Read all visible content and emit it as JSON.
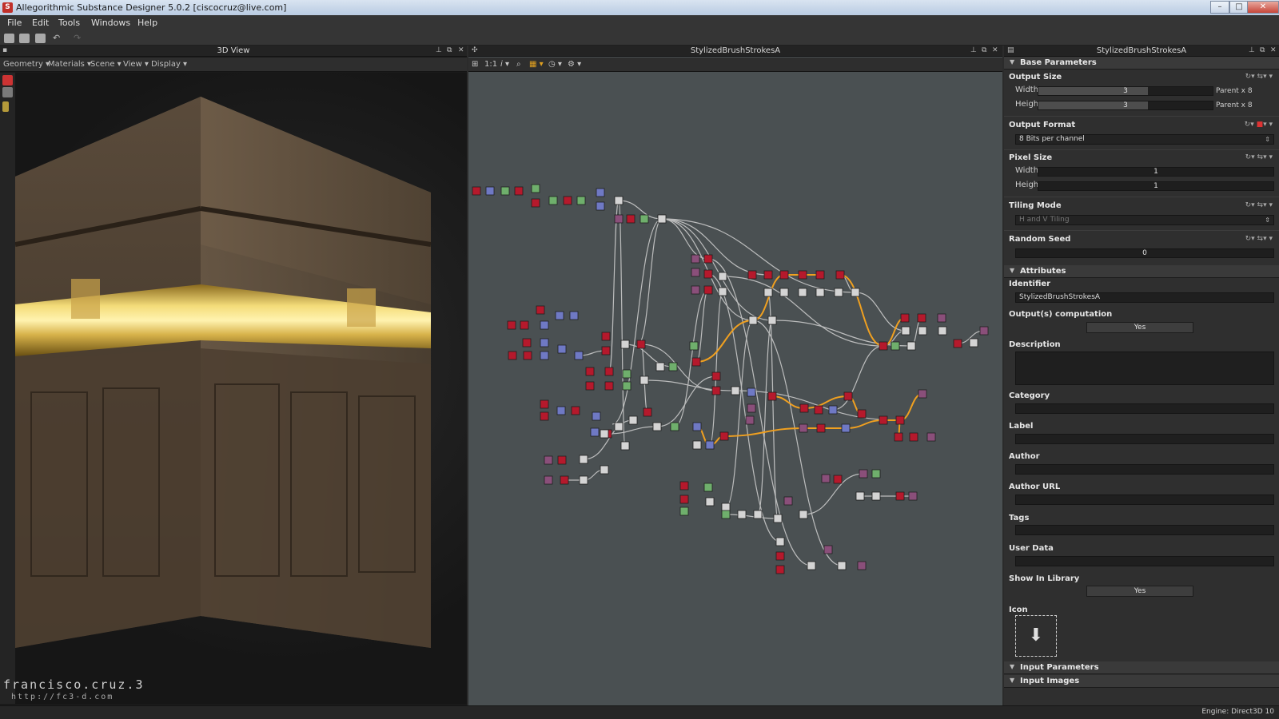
{
  "window": {
    "title": "Allegorithmic Substance Designer 5.0.2 [ciscocruz@live.com]",
    "app_icon": "S"
  },
  "menubar": [
    "File",
    "Edit",
    "Tools",
    "Windows",
    "Help"
  ],
  "view3d": {
    "header": "3D View",
    "submenu": [
      "Geometry",
      "Materials",
      "Scene",
      "View",
      "Display"
    ],
    "watermark": "francisco.cruz.3",
    "watermark_url": "http://fc3-d.com"
  },
  "graph": {
    "header": "StylizedBrushStrokesA",
    "zoom_label": "1:1"
  },
  "props": {
    "header": "StylizedBrushStrokesA",
    "base_parameters": "Base Parameters",
    "output_size": {
      "label": "Output Size",
      "width_label": "Width",
      "width_value": "3",
      "width_suffix": "Parent x 8",
      "height_label": "Height",
      "height_value": "3",
      "height_suffix": "Parent x 8"
    },
    "output_format": {
      "label": "Output Format",
      "value": "8 Bits per channel"
    },
    "pixel_size": {
      "label": "Pixel Size",
      "width_label": "Width",
      "width_value": "1",
      "height_label": "Height",
      "height_value": "1"
    },
    "tiling_mode": {
      "label": "Tiling Mode",
      "value": "H and V Tiling"
    },
    "random_seed": {
      "label": "Random Seed",
      "value": "0"
    },
    "attributes": "Attributes",
    "identifier": {
      "label": "Identifier",
      "value": "StylizedBrushStrokesA"
    },
    "outputs_computation": {
      "label": "Output(s) computation",
      "value": "Yes"
    },
    "description": {
      "label": "Description"
    },
    "category": {
      "label": "Category"
    },
    "label": {
      "label": "Label"
    },
    "author": {
      "label": "Author"
    },
    "author_url": {
      "label": "Author URL"
    },
    "tags": {
      "label": "Tags"
    },
    "user_data": {
      "label": "User Data"
    },
    "show_in_library": {
      "label": "Show In Library",
      "value": "Yes"
    },
    "icon": {
      "label": "Icon",
      "glyph": "download-icon"
    },
    "input_parameters": "Input Parameters",
    "input_images": "Input Images"
  },
  "status": {
    "engine": "Engine: Direct3D 10"
  },
  "colors": {
    "graph_bg": "#4a5052",
    "node_red": "#b5192c",
    "node_blue": "#6f79c4",
    "node_green": "#6faf6c",
    "node_white": "#d4d4d4",
    "node_purple": "#8a4f7a",
    "wire_highlight": "#f0a020"
  }
}
